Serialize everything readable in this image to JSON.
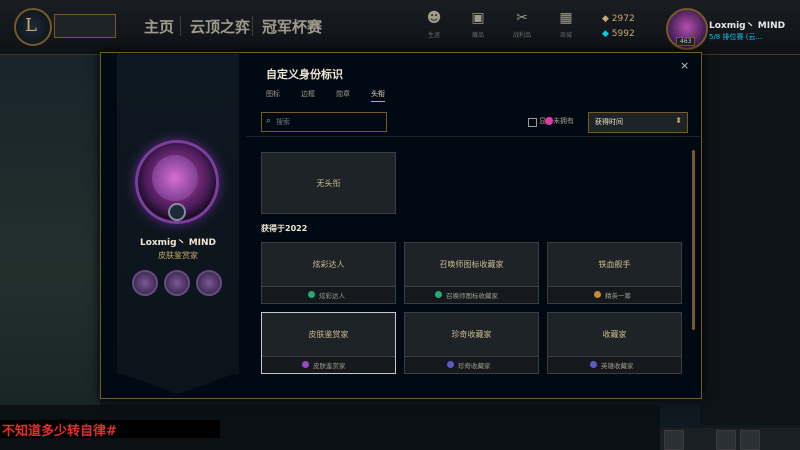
{
  "topnav": {
    "tabs": [
      "主页",
      "云顶之弈",
      "冠军杯赛"
    ]
  },
  "toolbar": [
    {
      "icon": "person-icon",
      "label": "生涯"
    },
    {
      "icon": "chest-icon",
      "label": "藏品"
    },
    {
      "icon": "tools-icon",
      "label": "战利品"
    },
    {
      "icon": "store-icon",
      "label": "商城"
    }
  ],
  "currency": {
    "be": "2972",
    "rp": "5992"
  },
  "profile": {
    "name": "Loxmig丶 MIND",
    "status": "5/8 排位赛 (云...",
    "level": "463"
  },
  "modal": {
    "title": "自定义身份标识",
    "tabs": [
      "图标",
      "边框",
      "勋章",
      "头衔"
    ],
    "active_tab": 3,
    "search_placeholder": "搜索",
    "filter_label": "显示未拥有",
    "sort_value": "获得时间",
    "close": "×",
    "player_name": "Loxmig丶 MIND",
    "player_title": "皮肤鉴赏家",
    "no_title_card": "无头衔",
    "section_label": "获得于2022",
    "cards": [
      {
        "title": "炫彩达人",
        "footer": "炫彩达人",
        "dot": "#2aa876"
      },
      {
        "title": "召唤师图标收藏家",
        "footer": "召唤师图标收藏家",
        "dot": "#2aa876"
      },
      {
        "title": "铁血舰手",
        "footer": "精英一筹",
        "dot": "#c8883a"
      },
      {
        "title": "皮肤鉴赏家",
        "footer": "皮肤鉴赏家",
        "dot": "#9a46c8",
        "selected": true
      },
      {
        "title": "珍奇收藏家",
        "footer": "珍奇收藏家",
        "dot": "#5a5ac8"
      },
      {
        "title": "收藏家",
        "footer": "英雄收藏家",
        "dot": "#5a5ac8"
      }
    ]
  },
  "overlay_caption": "不知道多少转自律#",
  "colors": {
    "gold": "#c8aa6e",
    "border": "#785a28",
    "bg": "#010a13"
  }
}
